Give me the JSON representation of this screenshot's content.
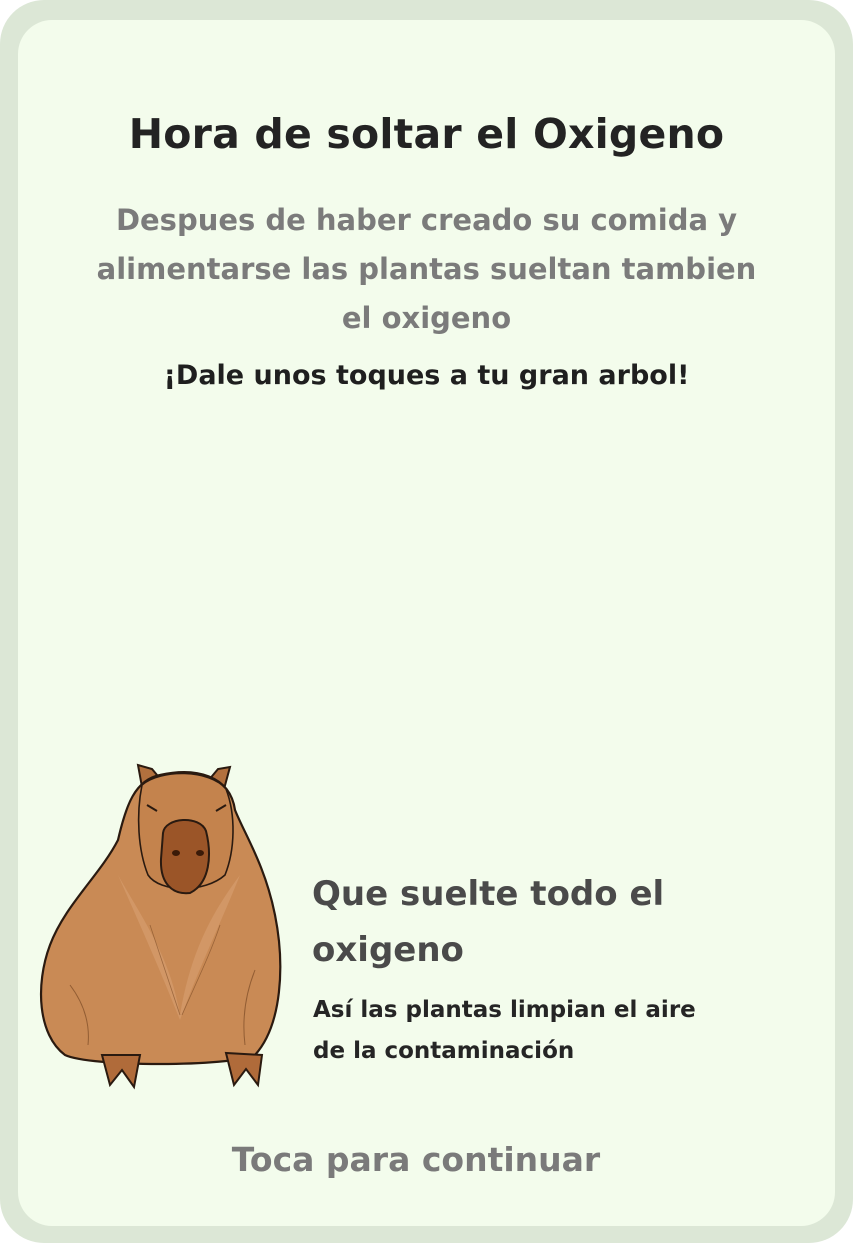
{
  "screen": {
    "title": "Hora de soltar el Oxigeno",
    "description": "Despues de haber creado su comida y alimentarse las plantas sueltan tambien el oxigeno",
    "call_to_action": "¡Dale unos toques a tu gran arbol!",
    "mascot": {
      "icon": "capybara-icon",
      "speech_title": "Que suelte todo el oxigeno",
      "speech_text": "Así las plantas limpian el aire de la contaminación"
    },
    "continue_label": "Toca para continuar"
  },
  "colors": {
    "outer_frame": "#dce7d6",
    "card_background": "#f3fcec",
    "capybara_fur": "#c98a55",
    "capybara_snout": "#9b5528"
  }
}
